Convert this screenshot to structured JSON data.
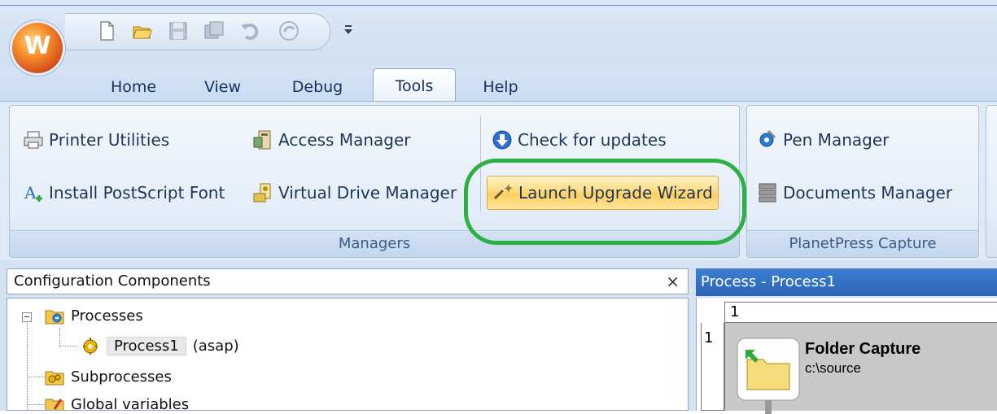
{
  "app": {
    "orb_letter": "W"
  },
  "quick_access": [
    "new-document",
    "open-folder",
    "save",
    "save-all",
    "undo",
    "redo",
    "customize"
  ],
  "tabs": [
    {
      "label": "Home",
      "active": false
    },
    {
      "label": "View",
      "active": false
    },
    {
      "label": "Debug",
      "active": false
    },
    {
      "label": "Tools",
      "active": true
    },
    {
      "label": "Help",
      "active": false
    }
  ],
  "ribbon": {
    "managers": {
      "label": "Managers",
      "printer_utilities": "Printer Utilities",
      "install_postscript_font": "Install PostScript Font",
      "access_manager": "Access Manager",
      "virtual_drive_manager": "Virtual Drive Manager",
      "check_for_updates": "Check for updates",
      "launch_upgrade_wizard": "Launch Upgrade Wizard"
    },
    "planetpress_capture": {
      "label": "PlanetPress Capture",
      "pen_manager": "Pen Manager",
      "documents_manager": "Documents Manager"
    }
  },
  "config_panel": {
    "title": "Configuration Components",
    "close": "×",
    "tree": {
      "processes": "Processes",
      "process1": "Process1",
      "process1_status": "(asap)",
      "subprocesses": "Subprocesses",
      "global_variables": "Global variables"
    }
  },
  "process_panel": {
    "title": "Process - Process1",
    "col_header": "1",
    "row_header": "1",
    "task_title": "Folder Capture",
    "task_path": "c:\\source"
  },
  "colors": {
    "highlight_border": "#2bb043",
    "active_button": "#ffd877",
    "panel_header": "#2a64b5"
  }
}
